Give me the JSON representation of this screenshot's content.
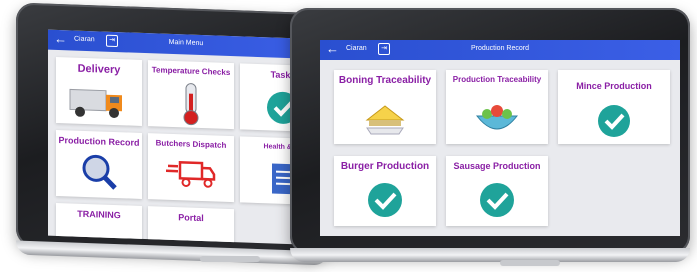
{
  "left_screen": {
    "header": {
      "back": "←",
      "user": "Ciaran",
      "logout": "⇥",
      "title": "Main Menu"
    },
    "tiles": [
      {
        "label": "Delivery",
        "icon": "delivery-truck-icon"
      },
      {
        "label": "Temperature Checks",
        "icon": "thermometer-icon"
      },
      {
        "label": "Tasks",
        "icon": "checkmark-icon"
      },
      {
        "label": "Production Record",
        "icon": "magnifier-icon"
      },
      {
        "label": "Butchers Dispatch",
        "icon": "fast-truck-icon"
      },
      {
        "label": "Health & Sa",
        "icon": "document-icon"
      },
      {
        "label": "TRAINING",
        "icon": ""
      },
      {
        "label": "Portal",
        "icon": ""
      }
    ]
  },
  "right_screen": {
    "header": {
      "back": "←",
      "user": "Ciaran",
      "logout": "⇥",
      "title": "Production Record"
    },
    "tiles": [
      {
        "label": "Boning Traceability",
        "icon": "sandwich-icon"
      },
      {
        "label": "Production Traceability",
        "icon": "salad-bowl-icon"
      },
      {
        "label": "Mince Production",
        "icon": "checkmark-icon"
      },
      {
        "label": "Burger Production",
        "icon": "checkmark-icon"
      },
      {
        "label": "Sausage Production",
        "icon": "checkmark-icon"
      }
    ]
  },
  "colors": {
    "accent_bar": "#3b5fe6",
    "tile_label": "#8a1fa5",
    "check_teal": "#1fa39a"
  }
}
